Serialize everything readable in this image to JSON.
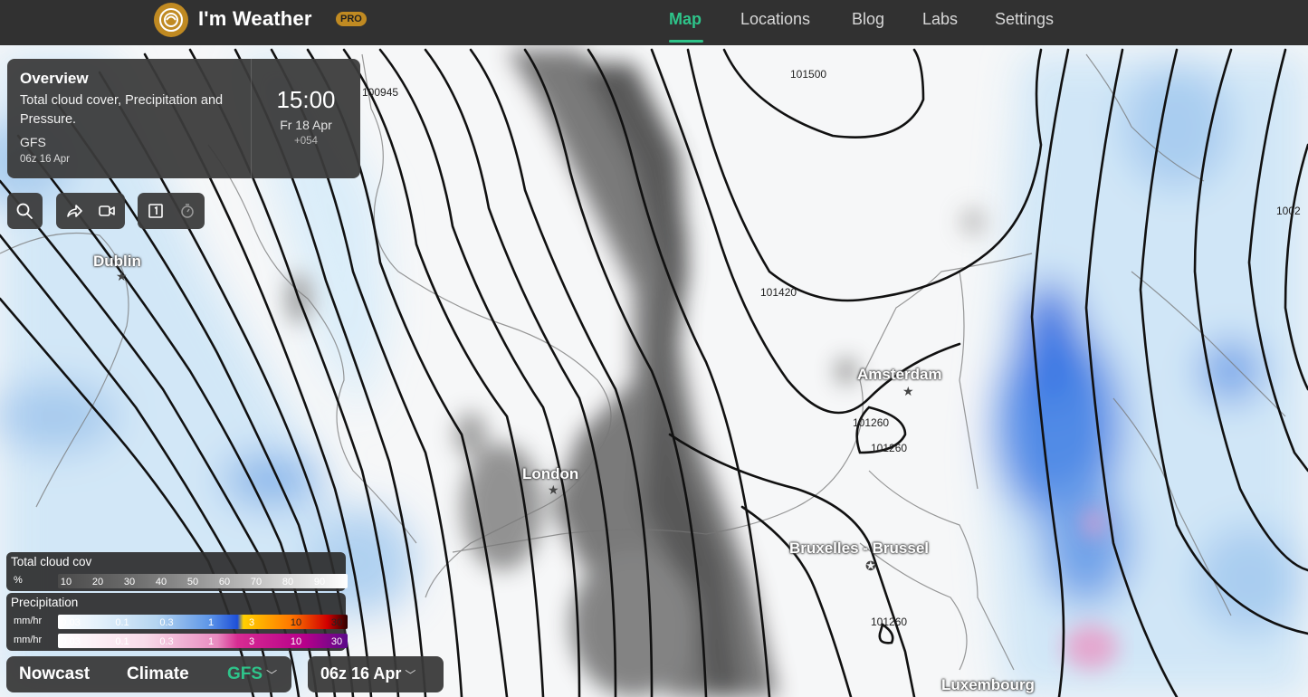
{
  "app": {
    "name": "I'm Weather",
    "badge": "PRO",
    "brand_color": "#c08a22",
    "accent_color": "#2ec48a"
  },
  "nav": {
    "items": [
      {
        "label": "Map",
        "active": true
      },
      {
        "label": "Locations",
        "active": false
      },
      {
        "label": "Blog",
        "active": false
      },
      {
        "label": "Labs",
        "active": false
      },
      {
        "label": "Settings",
        "active": false
      }
    ]
  },
  "overview": {
    "title": "Overview",
    "description": "Total cloud cover, Precipitation and Pressure.",
    "model": "GFS",
    "run": "06z 16 Apr",
    "time": "15:00",
    "date": "Fr 18 Apr",
    "step": "+054"
  },
  "tools": [
    "search-icon",
    "share-icon",
    "video-icon",
    "single-panel-icon",
    "timer-icon"
  ],
  "legend": {
    "cloud": {
      "title": "Total cloud cov",
      "unit": "%",
      "ticks": [
        "10",
        "20",
        "30",
        "40",
        "50",
        "60",
        "70",
        "80",
        "90"
      ]
    },
    "precip": {
      "title": "Precipitation",
      "rows": [
        {
          "unit": "mm/hr",
          "ticks": [
            "0.03",
            "0.1",
            "0.3",
            "1",
            "3",
            "10",
            "30"
          ]
        },
        {
          "unit": "mm/hr",
          "ticks": [
            "0.03",
            "0.1",
            "0.3",
            "1",
            "3",
            "10",
            "30"
          ]
        }
      ]
    }
  },
  "bottom": {
    "nowcast": "Nowcast",
    "climate": "Climate",
    "model_select": "GFS",
    "run_select": "06z 16 Apr"
  },
  "map": {
    "cities": [
      "Dublin",
      "London",
      "Amsterdam",
      "Bruxelles - Brussel",
      "Luxembourg"
    ],
    "isobar_labels": [
      "100945",
      "101500",
      "101420",
      "101260",
      "101260",
      "101260",
      "1002"
    ]
  }
}
